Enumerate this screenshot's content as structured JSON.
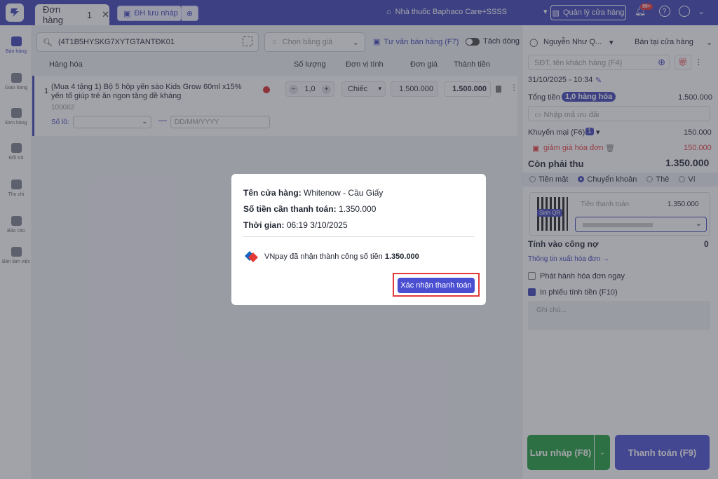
{
  "topbar": {
    "tab_label": "Đơn hàng",
    "tab_count": "1",
    "draft_label": "ĐH lưu nháp",
    "store_name": "Nhà thuốc Baphaco Care+SSSS",
    "manage_label": "Quản lý cửa hàng",
    "notif_badge": "99+"
  },
  "sidebar": {
    "items": [
      {
        "label": "Bán hàng",
        "icon": "cart-icon"
      },
      {
        "label": "Giao hàng",
        "icon": "truck-icon"
      },
      {
        "label": "Đơn hàng",
        "icon": "order-icon"
      },
      {
        "label": "Đổi trả",
        "icon": "return-icon"
      },
      {
        "label": "Thu chi",
        "icon": "cash-icon"
      },
      {
        "label": "Báo cáo",
        "icon": "report-icon"
      },
      {
        "label": "Bàn làm việc",
        "icon": "grid-icon"
      }
    ]
  },
  "toolbar": {
    "search_value": "(4T1B5HYSKG7XYTGTANTĐK01",
    "price_placeholder": "Chọn bảng giá",
    "consult_label": "Tư vấn bán hàng (F7)",
    "split_label": "Tách dòng"
  },
  "table": {
    "headers": [
      "Hàng hóa",
      "Số lượng",
      "Đơn vị tính",
      "Đơn giá",
      "Thành tiền"
    ],
    "rows": [
      {
        "index": "1",
        "name": "(Mua 4 tặng 1) Bộ 5 hộp yến sào Kids Grow 60ml x15% yến tổ giúp trẻ ăn ngon tăng đề kháng",
        "code": "100062",
        "lot_label": "Số lô:",
        "date_placeholder": "DD/MM/YYYY",
        "qty": "1,0",
        "unit": "Chiếc",
        "unit_price": "1.500.000",
        "total": "1.500.000"
      }
    ]
  },
  "right": {
    "staff": "Nguyễn Như Q...",
    "channel": "Bán tại cửa hàng",
    "customer_placeholder": "SĐT, tên khách hàng (F4)",
    "datetime": "31/10/2025 - 10:34",
    "total_label": "Tổng tiền",
    "items_badge": "1,0 hàng hóa",
    "total_value": "1.500.000",
    "coupon_placeholder": "Nhập mã ưu đãi",
    "promo_label": "Khuyến mại (F6)",
    "promo_count": "1",
    "promo_value": "150.000",
    "discount_label": "giảm giá hóa đơn",
    "discount_value": "150.000",
    "due_label": "Còn phải thu",
    "due_value": "1.350.000",
    "pay_methods": [
      "Tiền mặt",
      "Chuyển khoản",
      "Thẻ",
      "Ví"
    ],
    "qr_label": "Sinh QR",
    "pay_amount_label": "Tiền thanh toán",
    "pay_amount_value": "1.350.000",
    "debt_label": "Tính vào công nợ",
    "debt_value": "0",
    "invoice_link": "Thông tin xuất hóa đơn →",
    "issue_invoice": "Phát hành hóa đơn ngay",
    "print_receipt": "In phiếu tính tiền (F10)",
    "note_placeholder": "Ghi chú...",
    "save_draft": "Lưu nháp (F8)",
    "pay_button": "Thanh toán (F9)"
  },
  "modal": {
    "store_label": "Tên cửa hàng:",
    "store_value": "Whitenow - Cầu Giấy",
    "amount_label": "Số tiền cần thanh toán:",
    "amount_value": "1.350.000",
    "time_label": "Thời gian:",
    "time_value": "06:19 3/10/2025",
    "vnpay_msg": "VNpay đã nhận thành công số tiền",
    "vnpay_amount": "1.350.000",
    "confirm_label": "Xác nhận thanh toán"
  },
  "colors": {
    "brand": "#3e44b8",
    "accent": "#4a4ed1",
    "green": "#1f9e3c",
    "red": "#e43a3a"
  }
}
